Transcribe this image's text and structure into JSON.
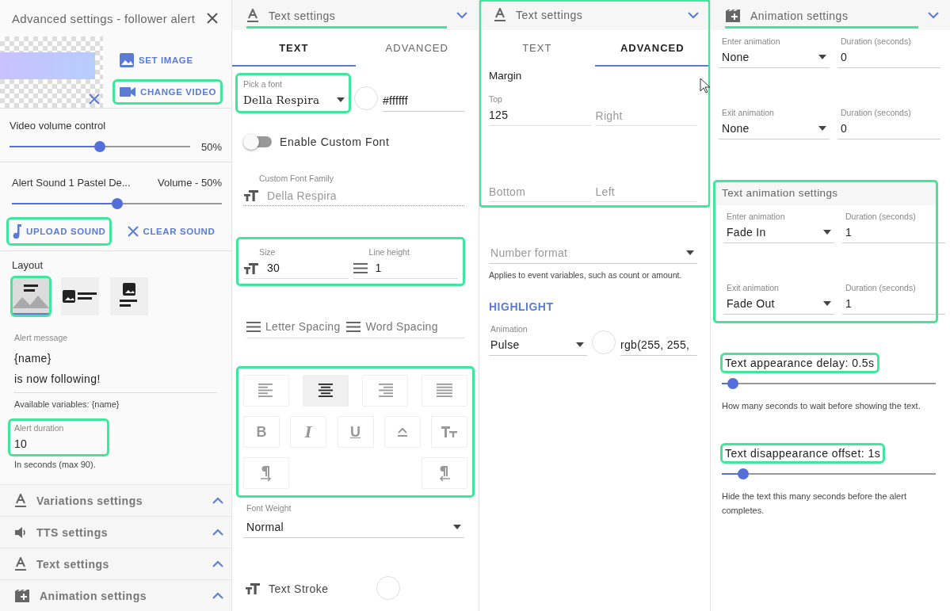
{
  "panel_alert": {
    "title": "Advanced settings - follower alert",
    "media_buttons": [
      {
        "kind": "image",
        "label": "SET IMAGE",
        "highlighted": false
      },
      {
        "kind": "video",
        "label": "CHANGE VIDEO",
        "highlighted": true
      }
    ],
    "video_volume": {
      "label": "Video volume control",
      "level": 0.5,
      "reading": "50%"
    },
    "sound": {
      "label": "Alert Sound 1 Pastel De...",
      "volume": "Volume - 50%",
      "level": 0.5
    },
    "sound_buttons": [
      {
        "kind": "upload",
        "label": "UPLOAD SOUND",
        "highlighted": true
      },
      {
        "kind": "clear",
        "label": "CLEAR SOUND",
        "highlighted": false
      }
    ],
    "layout": {
      "label": "Layout",
      "options": [
        {
          "kind": "overlay",
          "selected": true,
          "highlighted": true
        },
        {
          "kind": "side",
          "selected": false,
          "highlighted": false
        },
        {
          "kind": "stacked",
          "selected": false,
          "highlighted": false
        }
      ]
    },
    "alert_message": {
      "label": "Alert message",
      "lines": [
        "{name}",
        "is now following!"
      ],
      "help": "Available variables: {name}"
    },
    "alert_duration": {
      "label": "Alert duration",
      "value": "10",
      "help": "In seconds (max 90).",
      "highlighted": true
    },
    "sections": [
      {
        "kind": "text",
        "title": "Variations settings",
        "expanded": false
      },
      {
        "kind": "audio",
        "title": "TTS settings",
        "expanded": false
      },
      {
        "kind": "text",
        "title": "Text settings",
        "expanded": false
      },
      {
        "kind": "animation",
        "title": "Animation settings",
        "expanded": false
      }
    ]
  },
  "panel_text": {
    "header": {
      "kind": "text",
      "title": "Text settings",
      "expanded": true,
      "highlighted": true
    },
    "tabs": [
      {
        "label": "TEXT",
        "selected": true
      },
      {
        "label": "ADVANCED",
        "selected": false
      }
    ],
    "font": {
      "label": "Pick a font",
      "value": "Della Respira",
      "highlighted": true
    },
    "color": {
      "value": "#ffffff"
    },
    "custom_font": {
      "label": "Enable Custom Font",
      "on": false
    },
    "custom_family": {
      "label": "Custom Font Family",
      "placeholder": "Della Respira"
    },
    "size_group": {
      "highlighted": true,
      "size": {
        "label": "Size",
        "value": "30"
      },
      "line_height": {
        "label": "Line height",
        "value": "1"
      }
    },
    "spacing": [
      {
        "placeholder": "Letter Spacing"
      },
      {
        "placeholder": "Word Spacing"
      }
    ],
    "format": {
      "highlighted": true,
      "rows": [
        [
          {
            "kind": "align-left",
            "selected": false
          },
          {
            "kind": "align-center",
            "selected": true
          },
          {
            "kind": "align-right",
            "selected": false
          },
          {
            "kind": "align-justify",
            "selected": false
          }
        ],
        [
          {
            "kind": "bold",
            "label": "B",
            "selected": false
          },
          {
            "kind": "italic",
            "label": "I",
            "selected": false
          },
          {
            "kind": "underline",
            "label": "U",
            "selected": false
          },
          {
            "kind": "caps",
            "selected": false
          },
          {
            "kind": "small-caps",
            "selected": false
          }
        ],
        [
          {
            "kind": "ltr",
            "selected": false
          },
          {
            "kind": "rtl",
            "selected": false
          }
        ]
      ]
    },
    "font_weight": {
      "label": "Font Weight",
      "value": "Normal"
    },
    "text_stroke": {
      "label": "Text Stroke"
    }
  },
  "panel_advanced": {
    "group": {
      "highlighted": true,
      "header": {
        "kind": "text",
        "title": "Text settings",
        "expanded": true,
        "highlighted": false
      },
      "tabs": [
        {
          "label": "TEXT",
          "selected": false
        },
        {
          "label": "ADVANCED",
          "selected": true
        }
      ],
      "margin": {
        "label": "Margin",
        "fields": [
          {
            "label": "Top",
            "value": "125"
          },
          {
            "placeholder": "Right"
          },
          {
            "placeholder": "Bottom"
          },
          {
            "placeholder": "Left"
          }
        ]
      }
    },
    "number_format": {
      "placeholder": "Number format",
      "help": "Applies to event variables, such as count or amount."
    },
    "highlight": {
      "title": "HIGHLIGHT",
      "animation": {
        "label": "Animation",
        "value": "Pulse"
      },
      "color": {
        "value": "rgb(255, 255,"
      }
    }
  },
  "panel_animation": {
    "header": {
      "kind": "animation",
      "title": "Animation settings",
      "expanded": true,
      "highlighted": true
    },
    "rows": [
      {
        "select_label": "Enter animation",
        "select_value": "None",
        "duration_label": "Duration (seconds)",
        "duration_value": "0"
      },
      {
        "select_label": "Exit animation",
        "select_value": "None",
        "duration_label": "Duration (seconds)",
        "duration_value": "0"
      }
    ],
    "text_animation": {
      "title": "Text animation settings",
      "highlighted": true,
      "rows": [
        {
          "select_label": "Enter animation",
          "select_value": "Fade In",
          "duration_label": "Duration (seconds)",
          "duration_value": "1"
        },
        {
          "select_label": "Exit animation",
          "select_value": "Fade Out",
          "duration_label": "Duration (seconds)",
          "duration_value": "1"
        }
      ]
    },
    "delay": {
      "label": "Text appearance delay: 0.5s",
      "level": 0.05,
      "help": "How many seconds to wait before showing the text.",
      "highlighted": true
    },
    "offset": {
      "label": "Text disappearance offset: 1s",
      "level": 0.1,
      "help": "Hide the text this many seconds before the alert completes.",
      "highlighted": true
    }
  }
}
